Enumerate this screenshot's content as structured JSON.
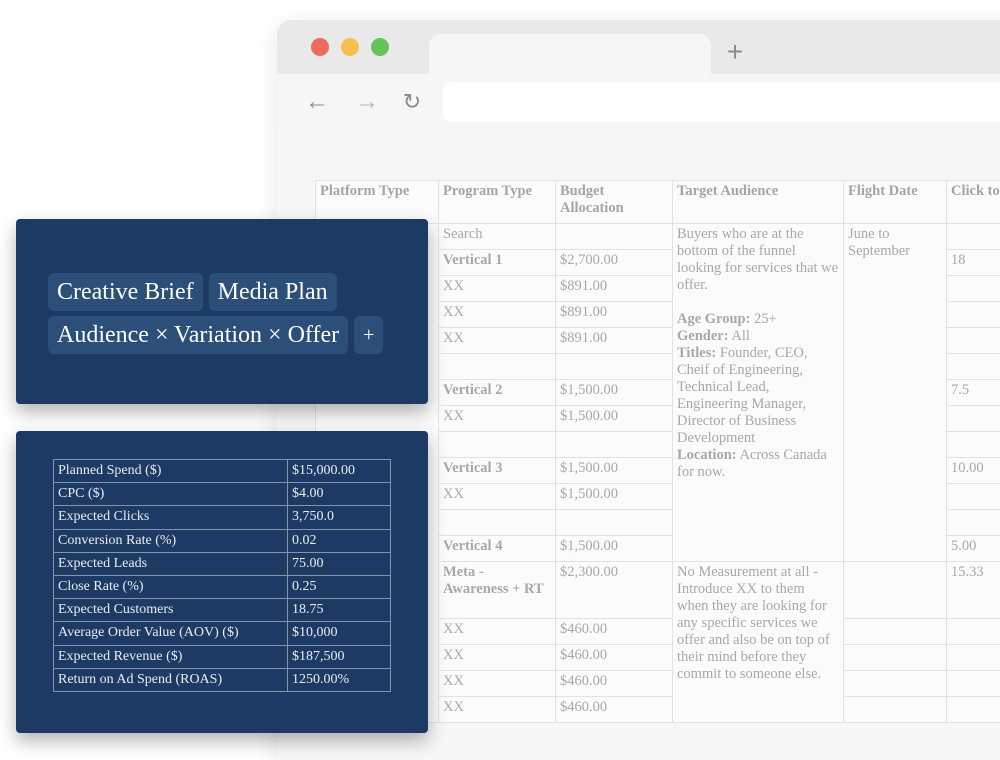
{
  "browser": {
    "new_tab": "+",
    "nav": {
      "back": "←",
      "forward": "→",
      "reload": "↻"
    }
  },
  "media_plan": {
    "headers": [
      "Platform Type",
      "Program Type",
      "Budget Allocation",
      "Target Audience",
      "Flight Date",
      "Click to (Conve"
    ],
    "rows": [
      [
        "",
        "Search",
        "",
        "",
        "",
        ""
      ],
      [
        "",
        "Vertical 1",
        "$2,700.00",
        "",
        "",
        "18"
      ],
      [
        "",
        "XX",
        "$891.00",
        "",
        "",
        ""
      ],
      [
        "",
        "XX",
        "$891.00",
        "",
        "",
        ""
      ],
      [
        "",
        "XX",
        "$891.00",
        "",
        "",
        ""
      ],
      [
        "",
        "",
        "",
        "",
        "",
        ""
      ],
      [
        "",
        "Vertical 2",
        "$1,500.00",
        "",
        "",
        "7.5"
      ],
      [
        "",
        "XX",
        "$1,500.00",
        "",
        "",
        ""
      ],
      [
        "",
        "",
        "",
        "",
        "",
        ""
      ],
      [
        "",
        "Vertical 3",
        "$1,500.00",
        "",
        "",
        "10.00"
      ],
      [
        "",
        "XX",
        "$1,500.00",
        "",
        "",
        ""
      ],
      [
        "",
        "",
        "",
        "",
        "",
        ""
      ],
      [
        "",
        "Vertical 4",
        "$1,500.00",
        "",
        "",
        "5.00"
      ],
      [
        "",
        "Meta - Awareness + RT",
        "$2,300.00",
        "",
        "",
        "15.33"
      ],
      [
        "",
        "XX",
        "$460.00",
        "",
        "",
        ""
      ],
      [
        "",
        "XX",
        "$460.00",
        "",
        "",
        ""
      ],
      [
        "",
        "XX",
        "$460.00",
        "",
        "",
        ""
      ],
      [
        "",
        "XX",
        "$460.00",
        "",
        "",
        ""
      ]
    ],
    "search_audience": {
      "intro": "Buyers who are at the bottom of the funnel looking for services that we offer.",
      "age_label": "Age Group:",
      "age_value": "25+",
      "gender_label": "Gender:",
      "gender_value": "All",
      "titles_label": "Titles:",
      "titles_value": "Founder, CEO, Cheif of Engineering, Technical Lead, Engineering Manager, Director of Business Development",
      "location_label": "Location:",
      "location_value": "Across Canada for now."
    },
    "flight_date": "June to September",
    "meta_audience": "No Measurement at all - Introduce XX to them when they are looking for any specific services we offer and also be on top of their mind before they commit to someone else."
  },
  "tags_panel": {
    "chips": [
      "Creative Brief",
      "Media Plan",
      "Audience × Variation × Offer"
    ],
    "add_label": "+"
  },
  "calculator": {
    "rows": [
      [
        "Planned Spend ($)",
        "$15,000.00"
      ],
      [
        "CPC ($)",
        "$4.00"
      ],
      [
        "Expected Clicks",
        "3,750.0"
      ],
      [
        "Conversion Rate (%)",
        "0.02"
      ],
      [
        "Expected Leads",
        "75.00"
      ],
      [
        "Close Rate (%)",
        "0.25"
      ],
      [
        "Expected Customers",
        "18.75"
      ],
      [
        "Average Order Value (AOV) ($)",
        "$10,000"
      ],
      [
        "Expected Revenue ($)",
        "$187,500"
      ],
      [
        "Return on Ad Spend (ROAS)",
        "1250.00%"
      ]
    ]
  }
}
